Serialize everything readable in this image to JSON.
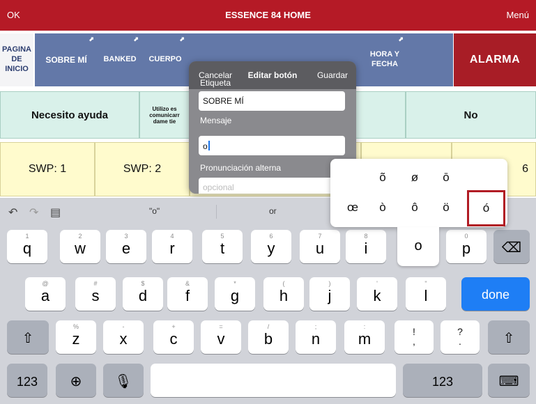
{
  "topbar": {
    "ok": "OK",
    "title": "ESSENCE 84 HOME",
    "menu": "Menú"
  },
  "row1": {
    "buttons": [
      "PAGINA DE INICIO",
      "SOBRE MÍ",
      "BANKED",
      "CUERPO",
      "HORA Y FECHA"
    ],
    "alarm": "ALARMA",
    "colors": {
      "nav": "#6378a8",
      "alarm": "#a81d26",
      "topbar": "#b51a26"
    }
  },
  "row2": {
    "help": "Necesito ayuda",
    "partial": "Utilizo es comunicarr dame tie",
    "no": "No"
  },
  "row3": {
    "swp1": "SWP: 1",
    "swp2": "SWP: 2",
    "six": "6"
  },
  "modal": {
    "cancel": "Cancelar",
    "title": "Editar botón",
    "save": "Guardar",
    "label_label": "Etiqueta",
    "label_value": "SOBRE MÍ",
    "message_label": "Mensaje",
    "message_value": "o",
    "alt_label": "Pronunciación alterna",
    "alt_placeholder": "opcional"
  },
  "keyboard": {
    "suggestions": [
      "\"o\"",
      "or"
    ],
    "accents": {
      "row1": [
        "õ",
        "ø",
        "ō"
      ],
      "row2": [
        "œ",
        "ò",
        "ô",
        "ö",
        "ó"
      ],
      "selected": "ó"
    },
    "row_q": [
      {
        "main": "q",
        "sub": "1"
      },
      {
        "main": "w",
        "sub": "2"
      },
      {
        "main": "e",
        "sub": "3"
      },
      {
        "main": "r",
        "sub": "4"
      },
      {
        "main": "t",
        "sub": "5"
      },
      {
        "main": "y",
        "sub": "6"
      },
      {
        "main": "u",
        "sub": "7"
      },
      {
        "main": "i",
        "sub": "8"
      },
      {
        "main": "o",
        "sub": ""
      },
      {
        "main": "p",
        "sub": "0"
      }
    ],
    "row_a": [
      {
        "main": "a",
        "sub": "@"
      },
      {
        "main": "s",
        "sub": "#"
      },
      {
        "main": "d",
        "sub": "$"
      },
      {
        "main": "f",
        "sub": "&"
      },
      {
        "main": "g",
        "sub": "*"
      },
      {
        "main": "h",
        "sub": "("
      },
      {
        "main": "j",
        "sub": ")"
      },
      {
        "main": "k",
        "sub": "'"
      },
      {
        "main": "l",
        "sub": "\""
      }
    ],
    "done": "done",
    "row_z": [
      {
        "main": "z",
        "sub": "%"
      },
      {
        "main": "x",
        "sub": "-"
      },
      {
        "main": "c",
        "sub": "+"
      },
      {
        "main": "v",
        "sub": "="
      },
      {
        "main": "b",
        "sub": "/"
      },
      {
        "main": "n",
        "sub": ";"
      },
      {
        "main": "m",
        "sub": ":"
      },
      {
        "main": "!\n,",
        "sub": ""
      },
      {
        "main": "?\n.",
        "sub": ""
      }
    ],
    "num_left": "123",
    "num_right": "123"
  }
}
